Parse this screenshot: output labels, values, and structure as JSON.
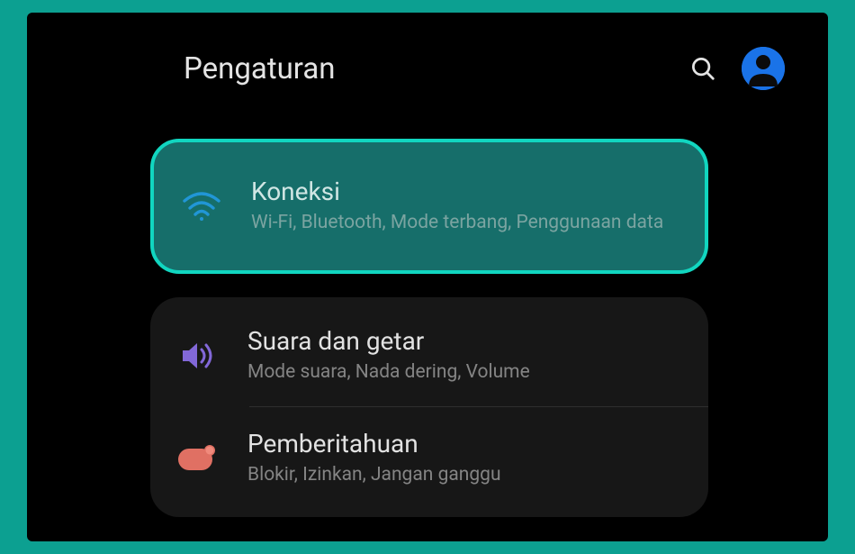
{
  "header": {
    "title": "Pengaturan"
  },
  "items": {
    "connections": {
      "title": "Koneksi",
      "subtitle": "Wi-Fi, Bluetooth, Mode terbang, Penggunaan data"
    },
    "sound": {
      "title": "Suara dan getar",
      "subtitle": "Mode suara, Nada dering, Volume"
    },
    "notifications": {
      "title": "Pemberitahuan",
      "subtitle": "Blokir, Izinkan, Jangan ganggu"
    }
  }
}
